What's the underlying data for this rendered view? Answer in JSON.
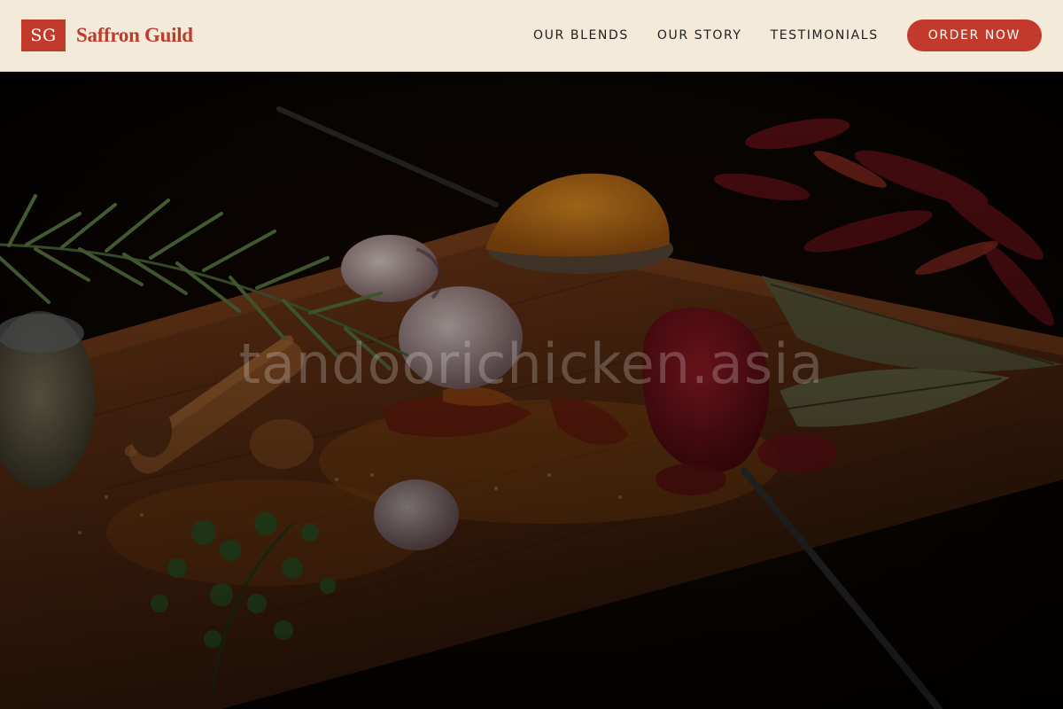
{
  "header": {
    "logo_text": "SG",
    "brand_name": "Saffron Guild",
    "nav": [
      {
        "label": "OUR BLENDS"
      },
      {
        "label": "OUR STORY"
      },
      {
        "label": "TESTIMONIALS"
      }
    ],
    "cta_label": "ORDER NOW"
  },
  "hero": {
    "watermark": "tandoorichicken.asia"
  },
  "colors": {
    "accent": "#c23a2c",
    "header_bg": "#f3ead9"
  }
}
